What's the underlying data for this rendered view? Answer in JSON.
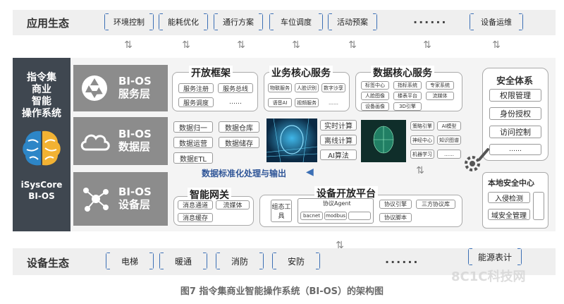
{
  "top_band": {
    "title": "应用生态",
    "items": [
      "环境控制",
      "能耗优化",
      "通行方案",
      "车位调度",
      "活动预案"
    ],
    "dots": "······",
    "last_item": "设备运维"
  },
  "bottom_band": {
    "title": "设备生态",
    "items": [
      "电梯",
      "暖通",
      "消防",
      "安防"
    ],
    "dots": "······",
    "last_item": "能源表计",
    "watermark": "8C1C科技网"
  },
  "left_column": {
    "title_lines": [
      "指令集",
      "商业",
      "智能",
      "操作系统"
    ],
    "brand_lines": [
      "iSysCore",
      "BI-OS"
    ]
  },
  "layers": [
    {
      "line1": "BI-OS",
      "line2": "服务层"
    },
    {
      "line1": "BI-OS",
      "line2": "数据层"
    },
    {
      "line1": "BI-OS",
      "line2": "设备层"
    }
  ],
  "open_framework": {
    "title": "开放框架",
    "items": [
      "服务注册",
      "服务总线",
      "服务调度",
      "……"
    ]
  },
  "business_core": {
    "title": "业务核心服务",
    "items": [
      "物联服务",
      "人脸识别",
      "数字沙孪",
      "语音AI",
      "视频服务",
      "……"
    ]
  },
  "data_core": {
    "title": "数据核心服务",
    "items": [
      "标签中心",
      "指标系统",
      "专家系统",
      "人脸图像",
      "楼表平台",
      "流媒体",
      "设备画像",
      "3D引擎"
    ]
  },
  "data_layer": {
    "items": [
      "数据归一",
      "数据仓库",
      "数据运营",
      "数据储存",
      "数据ETL"
    ],
    "compute": [
      "实时计算",
      "离线计算",
      "AI算法"
    ],
    "ai_items": [
      "策略引擎",
      "AI模型",
      "神经中心",
      "知识图谱",
      "机器学习",
      "……"
    ],
    "flow_label": "数据标准化处理与输出"
  },
  "gateway": {
    "title": "智能网关",
    "items": [
      "消息通道",
      "流媒体",
      "消息缓存"
    ]
  },
  "device_platform": {
    "title": "设备开放平台",
    "tool": "组态工具",
    "agent": "协议Agent",
    "protocols": [
      "bacnet",
      "modbus"
    ],
    "items": [
      "协议引擎",
      "协议脚本",
      "三方协议库"
    ]
  },
  "security": {
    "title": "安全体系",
    "items": [
      "权限管理",
      "身份授权",
      "访问控制",
      "……"
    ]
  },
  "local_security": {
    "title": "本地安全中心",
    "items": [
      "入侵检测",
      "域安全管理"
    ]
  },
  "caption": "图7 指令集商业智能操作系统（BI-OS）的架构图",
  "colors": {
    "accent": "#3b6fb5",
    "dark_panel": "#3f4750",
    "layer_gray": "#8c8c8c",
    "band": "#efefef"
  }
}
